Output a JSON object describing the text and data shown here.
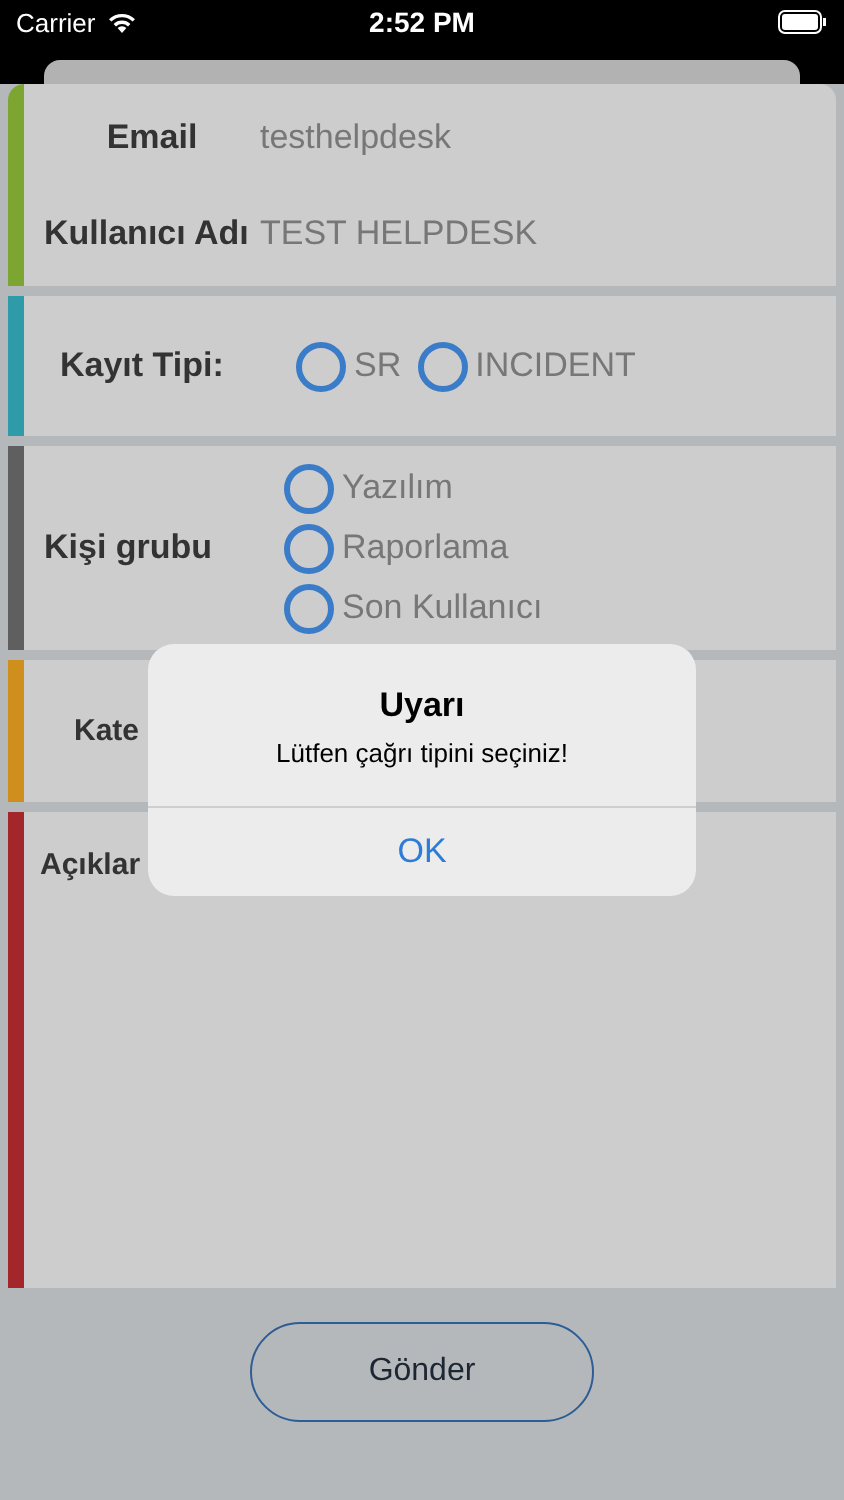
{
  "status_bar": {
    "carrier": "Carrier",
    "time": "2:52 PM"
  },
  "sections": [
    {
      "kind": "fields",
      "color": "#7ca532",
      "fields": [
        {
          "label": "Email",
          "value": "testhelpdesk"
        },
        {
          "label": "Kullanıcı Adı",
          "value": "TEST HELPDESK"
        }
      ]
    },
    {
      "kind": "radio_row",
      "color": "#2f9aa8",
      "label": "Kayıt Tipi:",
      "options": [
        {
          "label": "SR",
          "selected": false
        },
        {
          "label": "INCIDENT",
          "selected": false
        }
      ]
    },
    {
      "kind": "radio_column",
      "color": "#5f5f5f",
      "label": "Kişi grubu",
      "options": [
        {
          "label": "Yazılım",
          "selected": false
        },
        {
          "label": "Raporlama",
          "selected": false
        },
        {
          "label": "Son Kullanıcı",
          "selected": false
        }
      ]
    },
    {
      "kind": "label",
      "color": "#cf8f1c",
      "label": "Kate"
    },
    {
      "kind": "textarea",
      "color": "#a2262a",
      "label": "Açıklar"
    }
  ],
  "submit_button": "Gönder",
  "alert": {
    "title": "Uyarı",
    "message": "Lütfen çağrı tipini seçiniz!",
    "button": "OK"
  }
}
